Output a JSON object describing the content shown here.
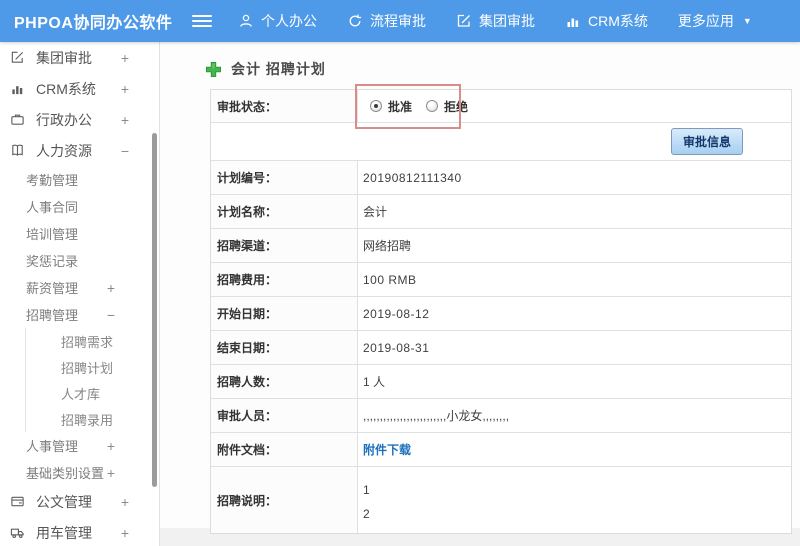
{
  "header": {
    "logo": "PHPOA协同办公软件",
    "nav_personal": "个人办公",
    "nav_process": "流程审批",
    "nav_group": "集团审批",
    "nav_crm": "CRM系统",
    "nav_more": "更多应用"
  },
  "sidebar": {
    "items": [
      {
        "label": "集团审批",
        "icon": "edit-square-icon",
        "toggle": "+"
      },
      {
        "label": "CRM系统",
        "icon": "bar-chart-icon",
        "toggle": "+"
      },
      {
        "label": "行政办公",
        "icon": "briefcase-icon",
        "toggle": "+"
      },
      {
        "label": "人力资源",
        "icon": "book-icon",
        "toggle": "−"
      },
      {
        "label": "考勤管理"
      },
      {
        "label": "人事合同"
      },
      {
        "label": "培训管理"
      },
      {
        "label": "奖惩记录"
      },
      {
        "label": "薪资管理",
        "toggle": "+"
      },
      {
        "label": "招聘管理",
        "toggle": "−"
      },
      {
        "label": "招聘需求"
      },
      {
        "label": "招聘计划"
      },
      {
        "label": "人才库"
      },
      {
        "label": "招聘录用"
      },
      {
        "label": "人事管理",
        "toggle": "+"
      },
      {
        "label": "基础类别设置",
        "toggle": "+"
      },
      {
        "label": "公文管理",
        "icon": "wallet-icon",
        "toggle": "+"
      },
      {
        "label": "用车管理",
        "icon": "truck-icon",
        "toggle": "+"
      }
    ]
  },
  "main": {
    "page_title": "会计 招聘计划",
    "approve_info_button": "审批信息",
    "form": {
      "status_label": "审批状态：",
      "radio_approve": "批准",
      "radio_reject": "拒绝",
      "approve_checked": true,
      "reject_checked": false,
      "rows": [
        {
          "label": "计划编号：",
          "value": "20190812111340"
        },
        {
          "label": "计划名称：",
          "value": "会计"
        },
        {
          "label": "招聘渠道：",
          "value": "网络招聘"
        },
        {
          "label": "招聘费用：",
          "value": "100 RMB"
        },
        {
          "label": "开始日期：",
          "value": "2019-08-12"
        },
        {
          "label": "结束日期：",
          "value": "2019-08-31"
        },
        {
          "label": "招聘人数：",
          "value": "1 人"
        },
        {
          "label": "审批人员：",
          "value": ",,,,,,,,,,,,,,,,,,,,,,,,,小龙女,,,,,,,,"
        }
      ],
      "attachment_label": "附件文档：",
      "attachment_link": "附件下载",
      "description_label": "招聘说明：",
      "description_line1": "1",
      "description_line2": "2"
    }
  },
  "colors": {
    "header_blue": "#4e9ae8",
    "link_blue": "#1e71bd",
    "highlight_red": "#d98c8c",
    "plus_green": "#45b649",
    "button_face": "#a6cff2"
  }
}
